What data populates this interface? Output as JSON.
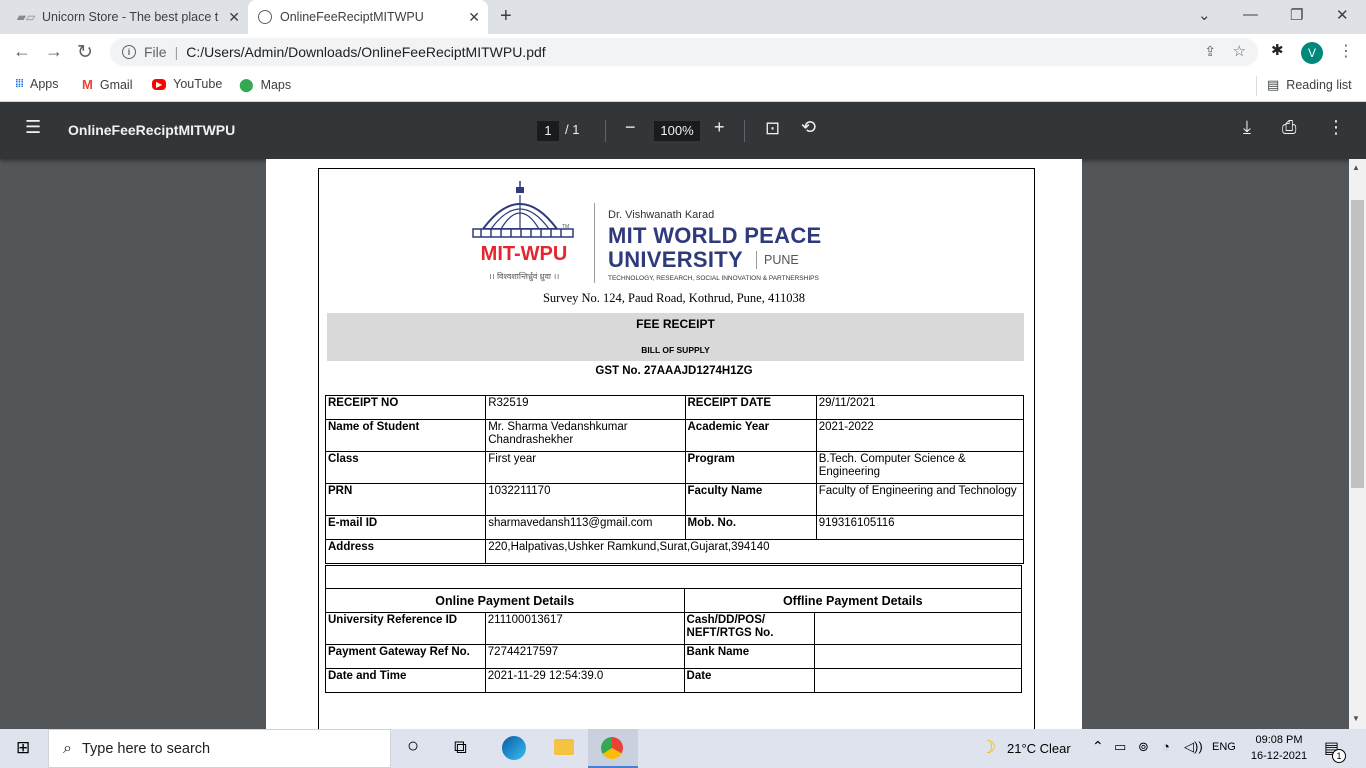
{
  "browser": {
    "tabs": [
      {
        "title": "Unicorn Store - The best place to"
      },
      {
        "title": "OnlineFeeReciptMITWPU"
      }
    ],
    "omnibox": {
      "scheme_label": "File",
      "url": "C:/Users/Admin/Downloads/OnlineFeeReciptMITWPU.pdf"
    },
    "profile_initial": "V",
    "bookmarks": [
      {
        "label": "Apps"
      },
      {
        "label": "Gmail"
      },
      {
        "label": "YouTube"
      },
      {
        "label": "Maps"
      }
    ],
    "reading_list": "Reading list"
  },
  "pdf_viewer": {
    "title": "OnlineFeeReciptMITWPU",
    "page_current": "1",
    "page_total": "/ 1",
    "zoom": "100%"
  },
  "receipt": {
    "logo_short": "MIT-WPU",
    "logo_motto": "।। विश्वशान्तिर्ध्रुवं ध्रुवा ।।",
    "logo_tm": "TM",
    "org_founder": "Dr. Vishwanath Karad",
    "org_line1": "MIT WORLD PEACE",
    "org_line2": "UNIVERSITY",
    "org_city": "PUNE",
    "org_tagline": "TECHNOLOGY, RESEARCH, SOCIAL INNOVATION & PARTNERSHIPS",
    "address": "Survey No. 124, Paud Road, Kothrud, Pune, 411038",
    "heading": "FEE RECEIPT",
    "subheading": "BILL OF SUPPLY",
    "gst": "GST No. 27AAAJD1274H1ZG",
    "rows": [
      {
        "l1": "RECEIPT NO",
        "v1": "R32519",
        "l2": "RECEIPT DATE",
        "v2": "29/11/2021"
      },
      {
        "l1": "Name of Student",
        "v1": "Mr. Sharma Vedanshkumar Chandrashekher",
        "l2": "Academic Year",
        "v2": "2021-2022"
      },
      {
        "l1": "Class",
        "v1": "First year",
        "l2": "Program",
        "v2": "B.Tech. Computer Science & Engineering"
      },
      {
        "l1": "PRN",
        "v1": "1032211170",
        "l2": "Faculty Name",
        "v2": "Faculty of Engineering and Technology"
      },
      {
        "l1": "E-mail ID",
        "v1": "sharmavedansh113@gmail.com",
        "l2": "Mob. No.",
        "v2": "919316105116"
      }
    ],
    "address_row": {
      "label": "Address",
      "value": "220,Halpativas,Ushker Ramkund,Surat,Gujarat,394140"
    },
    "online_heading": "Online Payment Details",
    "offline_heading": "Offline Payment Details",
    "payment_rows": [
      {
        "l1": "University Reference ID",
        "v1": "211100013617",
        "l2": "Cash/DD/POS/ NEFT/RTGS No.",
        "v2": ""
      },
      {
        "l1": "Payment Gateway Ref No.",
        "v1": "72744217597",
        "l2": "Bank Name",
        "v2": ""
      },
      {
        "l1": "Date and Time",
        "v1": "2021-11-29 12:54:39.0",
        "l2": "Date",
        "v2": ""
      }
    ]
  },
  "taskbar": {
    "search_placeholder": "Type here to search",
    "weather": "21°C  Clear",
    "language": "ENG",
    "time": "09:08 PM",
    "date": "16-12-2021",
    "notification_count": "1"
  }
}
